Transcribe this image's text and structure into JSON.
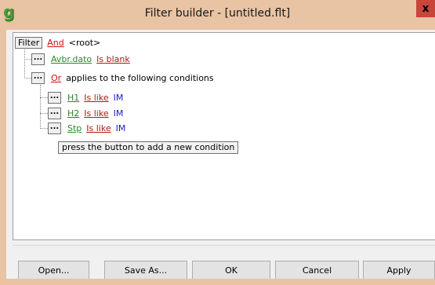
{
  "window": {
    "title": "Filter builder - [untitled.flt]",
    "close_glyph": "x",
    "app_icon_glyph": "g"
  },
  "tree": {
    "root": {
      "filter_button": "Filter",
      "operator": "And",
      "label": "<root>"
    },
    "dots_label": "...",
    "cond1": {
      "field": "Avbr.dato",
      "operator": "Is blank"
    },
    "group": {
      "operator": "Or",
      "label": "applies to the following conditions"
    },
    "conditions": [
      {
        "field": "H1",
        "operator": "Is like",
        "value": "IM"
      },
      {
        "field": "H2",
        "operator": "Is like",
        "value": "IM"
      },
      {
        "field": "Stp",
        "operator": "Is like",
        "value": "IM"
      }
    ],
    "add_hint": "press the button to add a new condition"
  },
  "buttons": {
    "open": "Open...",
    "save_as": "Save As...",
    "ok": "OK",
    "cancel": "Cancel",
    "apply": "Apply"
  }
}
